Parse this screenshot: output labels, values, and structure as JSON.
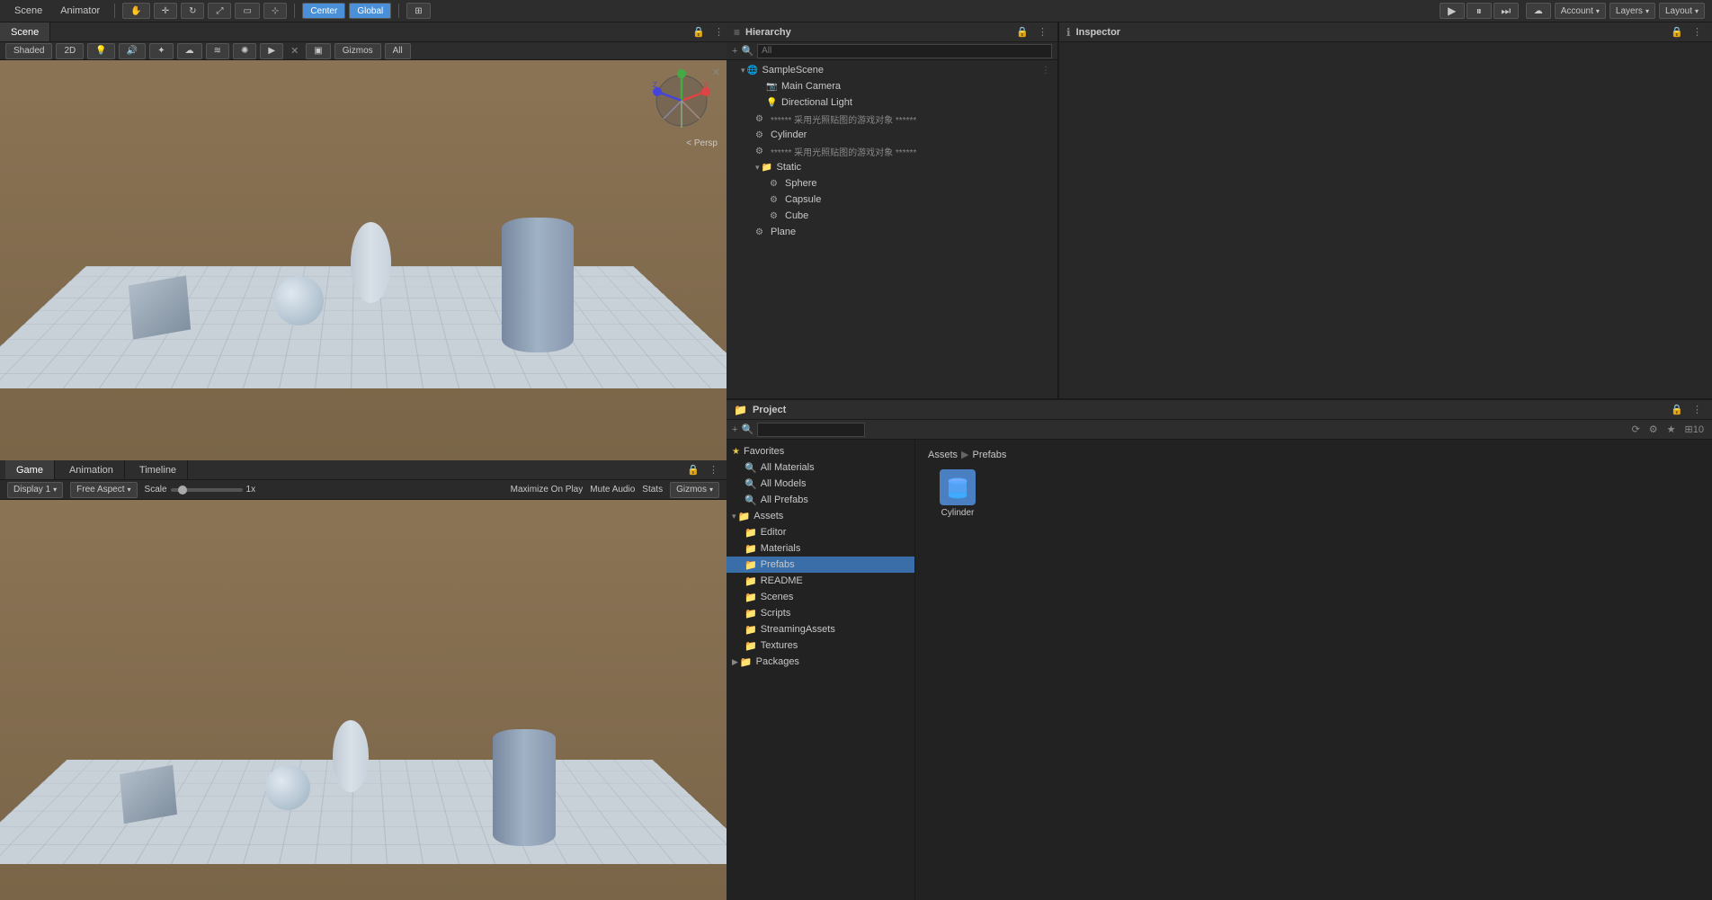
{
  "topbar": {
    "tabs": [
      {
        "label": "Scene",
        "active": true
      },
      {
        "label": "Animator",
        "active": false
      }
    ],
    "tools": [
      "hand",
      "move",
      "rotate",
      "scale",
      "rect",
      "transform"
    ],
    "pivot": "Center",
    "space": "Global",
    "play": "▶",
    "pause": "⏸",
    "step": "⏭",
    "account_label": "Account",
    "layers_label": "Layers",
    "layout_label": "Layout"
  },
  "scene_view": {
    "tab_label": "Scene",
    "shading_label": "Shaded",
    "view_2d": "2D",
    "gizmos_label": "Gizmos",
    "all_label": "All",
    "persp_label": "< Persp"
  },
  "game_view": {
    "tabs": [
      "Game",
      "Animation",
      "Timeline"
    ],
    "display": "Display 1",
    "aspect": "Free Aspect",
    "scale_label": "Scale",
    "scale_val": "1x",
    "maximize": "Maximize On Play",
    "mute": "Mute Audio",
    "stats": "Stats",
    "gizmos": "Gizmos"
  },
  "hierarchy": {
    "title": "Hierarchy",
    "search_placeholder": "All",
    "items": [
      {
        "id": "sample-scene",
        "label": "SampleScene",
        "level": 0,
        "arrow": "▾",
        "icon": "🌐",
        "has_more": true
      },
      {
        "id": "main-camera",
        "label": "Main Camera",
        "level": 1,
        "arrow": "",
        "icon": "📷"
      },
      {
        "id": "dir-light",
        "label": "Directional Light",
        "level": 1,
        "arrow": "",
        "icon": "💡"
      },
      {
        "id": "unnamed1",
        "label": "****** 采用光照贴图的游戏对象 ******",
        "level": 1,
        "arrow": "",
        "icon": "⚙",
        "dimmed": true
      },
      {
        "id": "cylinder",
        "label": "Cylinder",
        "level": 1,
        "arrow": "",
        "icon": "⚙"
      },
      {
        "id": "unnamed2",
        "label": "****** 采用光照贴图的游戏对象 ******",
        "level": 1,
        "arrow": "",
        "icon": "⚙",
        "dimmed": true
      },
      {
        "id": "static",
        "label": "Static",
        "level": 1,
        "arrow": "▾",
        "icon": "📁"
      },
      {
        "id": "sphere",
        "label": "Sphere",
        "level": 2,
        "arrow": "",
        "icon": "⚙"
      },
      {
        "id": "capsule",
        "label": "Capsule",
        "level": 2,
        "arrow": "",
        "icon": "⚙"
      },
      {
        "id": "cube",
        "label": "Cube",
        "level": 2,
        "arrow": "",
        "icon": "⚙"
      },
      {
        "id": "plane",
        "label": "Plane",
        "level": 1,
        "arrow": "",
        "icon": "⚙"
      }
    ]
  },
  "inspector": {
    "title": "Inspector"
  },
  "project": {
    "title": "Project",
    "breadcrumb": [
      "Assets",
      "Prefabs"
    ],
    "sidebar": {
      "favorites": {
        "label": "Favorites",
        "children": [
          {
            "label": "All Materials"
          },
          {
            "label": "All Models"
          },
          {
            "label": "All Prefabs"
          }
        ]
      },
      "assets": {
        "label": "Assets",
        "children": [
          {
            "label": "Editor"
          },
          {
            "label": "Materials"
          },
          {
            "label": "Prefabs",
            "selected": true
          },
          {
            "label": "README"
          },
          {
            "label": "Scenes"
          },
          {
            "label": "Scripts"
          },
          {
            "label": "StreamingAssets"
          },
          {
            "label": "Textures"
          }
        ]
      },
      "packages": {
        "label": "Packages"
      }
    },
    "assets": [
      {
        "label": "Cylinder",
        "icon": "⬡"
      }
    ]
  }
}
